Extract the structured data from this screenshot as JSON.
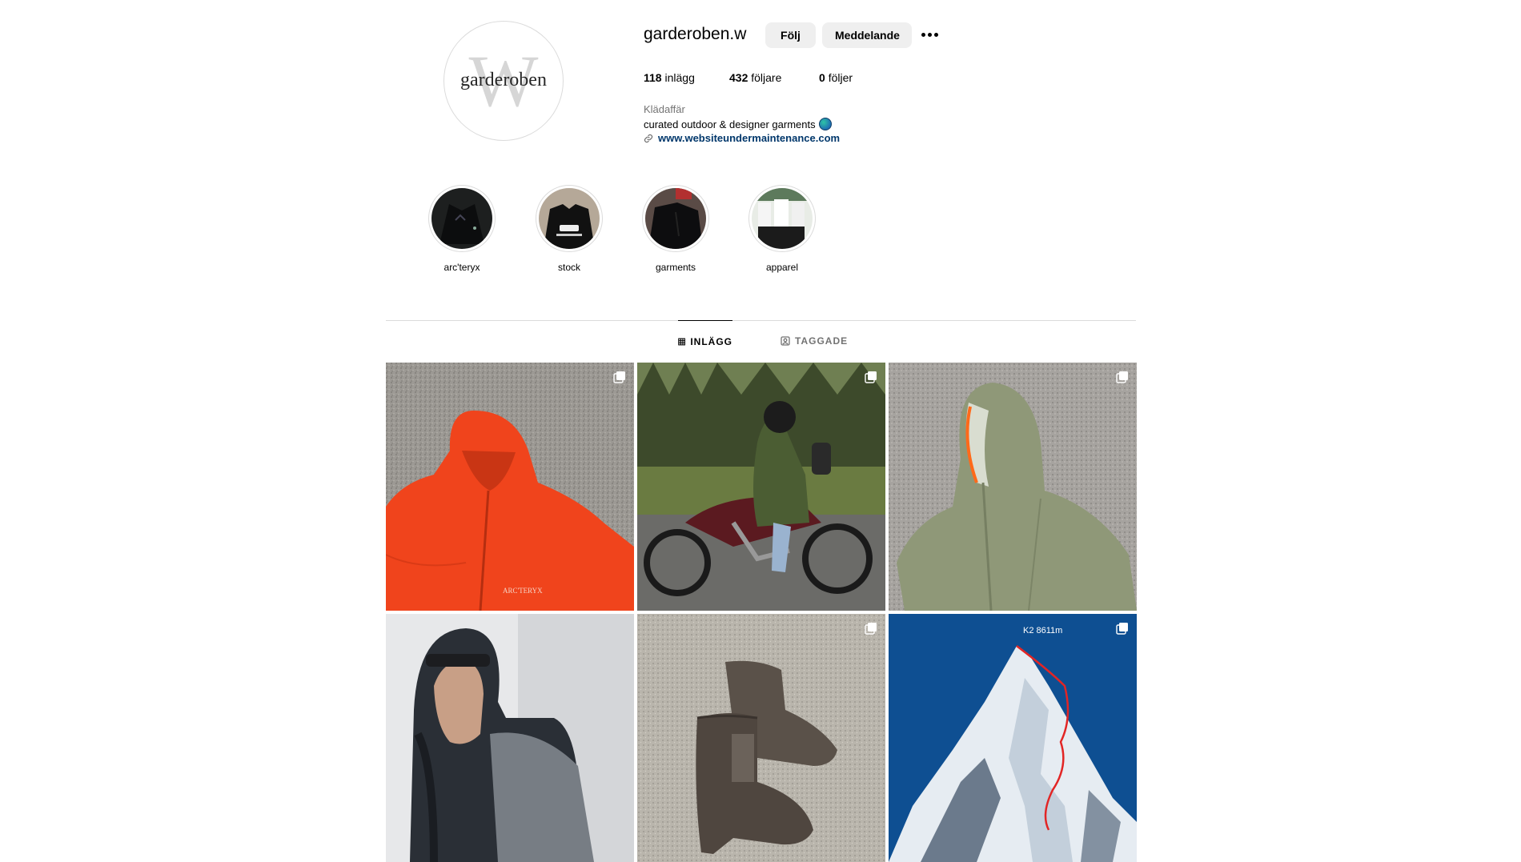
{
  "profile": {
    "username": "garderoben.w",
    "avatar_letter": "W",
    "avatar_word": "garderoben",
    "follow_label": "Följ",
    "message_label": "Meddelande",
    "stats": {
      "posts_count": "118",
      "posts_label": "inlägg",
      "followers_count": "432",
      "followers_label": "följare",
      "following_count": "0",
      "following_label": "följer"
    },
    "category": "Klädaffär",
    "bio": "curated outdoor & designer garments",
    "link": "www.websiteundermaintenance.com"
  },
  "highlights": [
    {
      "label": "arc'teryx"
    },
    {
      "label": "stock"
    },
    {
      "label": "garments"
    },
    {
      "label": "apparel"
    }
  ],
  "tabs": {
    "posts": "INLÄGG",
    "tagged": "TAGGADE"
  },
  "posts": {
    "k2_caption": "K2 8611m"
  },
  "icons": {
    "more": "more-horizontal-icon",
    "globe": "globe-emoji-icon",
    "link": "link-icon",
    "grid": "grid-icon",
    "tagged": "tagged-icon",
    "carousel": "carousel-icon"
  },
  "colors": {
    "button_bg": "#efefef",
    "link": "#00376b",
    "muted": "#737373",
    "divider": "#dbdbdb"
  }
}
